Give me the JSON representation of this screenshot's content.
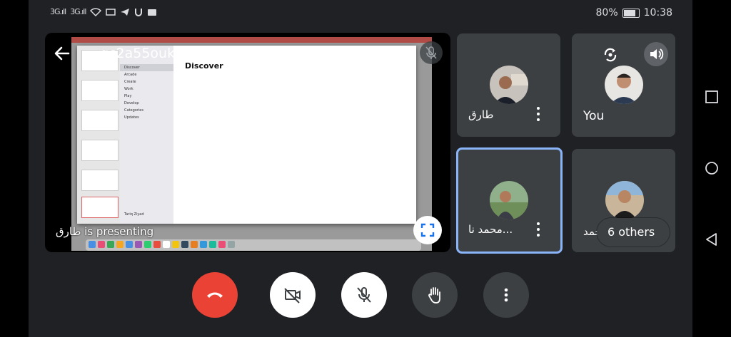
{
  "status_bar": {
    "signal_1": "3G.ıll",
    "signal_2": "3G.ıll",
    "battery_percent": "80%",
    "time": "10:38"
  },
  "meeting": {
    "code": "gc2a55oukq",
    "presenter_label": "طارق is presenting"
  },
  "shared_screen": {
    "window_title": "Discover",
    "sidebar_items": [
      "Discover",
      "Arcade",
      "Create",
      "Work",
      "Play",
      "Develop",
      "Categories",
      "Updates"
    ],
    "user": "Tariq Ziyad"
  },
  "participants": [
    {
      "name": "طارق"
    },
    {
      "name": "You"
    },
    {
      "name": "محمد نا..."
    },
    {
      "name": "محمد"
    }
  ],
  "others_label": "6 others",
  "colors": {
    "end_call": "#ea4335",
    "selected_border": "#8ab4f8",
    "tile": "#3c4043"
  }
}
